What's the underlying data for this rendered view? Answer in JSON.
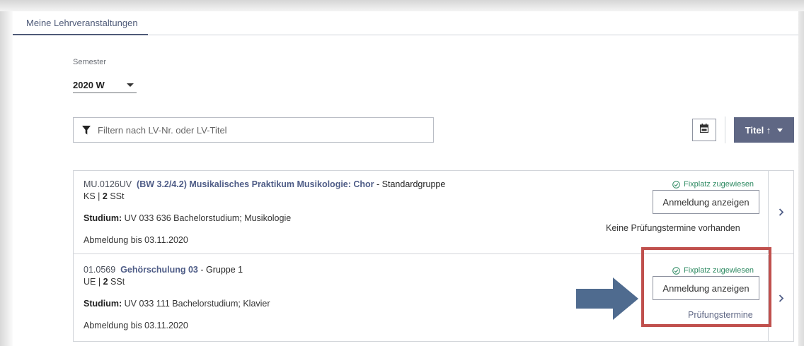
{
  "tabs": {
    "active_label": "Meine Lehrveranstaltungen"
  },
  "semester": {
    "label": "Semester",
    "value": "2020 W"
  },
  "filter": {
    "placeholder": "Filtern nach LV-Nr. oder LV-Titel",
    "icon": "filter-icon"
  },
  "toolbar": {
    "calendar_icon": "calendar-icon",
    "sort_label": "Titel ↑"
  },
  "courses": [
    {
      "number": "MU.0126UV",
      "title": "(BW 3.2/4.2) Musikalisches Praktikum Musikologie: Chor",
      "group": " - Standardgruppe",
      "type": "KS",
      "sst_value": "2",
      "sst_unit": "SSt",
      "study_label": "Studium:",
      "study_value": " UV 033 636 Bachelorstudium; Musikologie",
      "deregistration": "Abmeldung bis 03.11.2020",
      "status": "Fixplatz zugewiesen",
      "button_label": "Anmeldung anzeigen",
      "exam_text": "Keine Prüfungstermine vorhanden"
    },
    {
      "number": "01.0569",
      "title": "Gehörschulung 03",
      "group": " - Gruppe 1",
      "type": "UE",
      "sst_value": "2",
      "sst_unit": "SSt",
      "study_label": "Studium:",
      "study_value": " UV 033 111 Bachelorstudium; Klavier",
      "deregistration": "Abmeldung bis 03.11.2020",
      "status": "Fixplatz zugewiesen",
      "button_label": "Anmeldung anzeigen",
      "exam_link": "Prüfungstermine"
    }
  ],
  "colors": {
    "accent": "#5f6784",
    "link": "#4f5d87",
    "status_green": "#2e8a62",
    "highlight_red": "#c0504d",
    "arrow_blue": "#4f6b8f"
  }
}
